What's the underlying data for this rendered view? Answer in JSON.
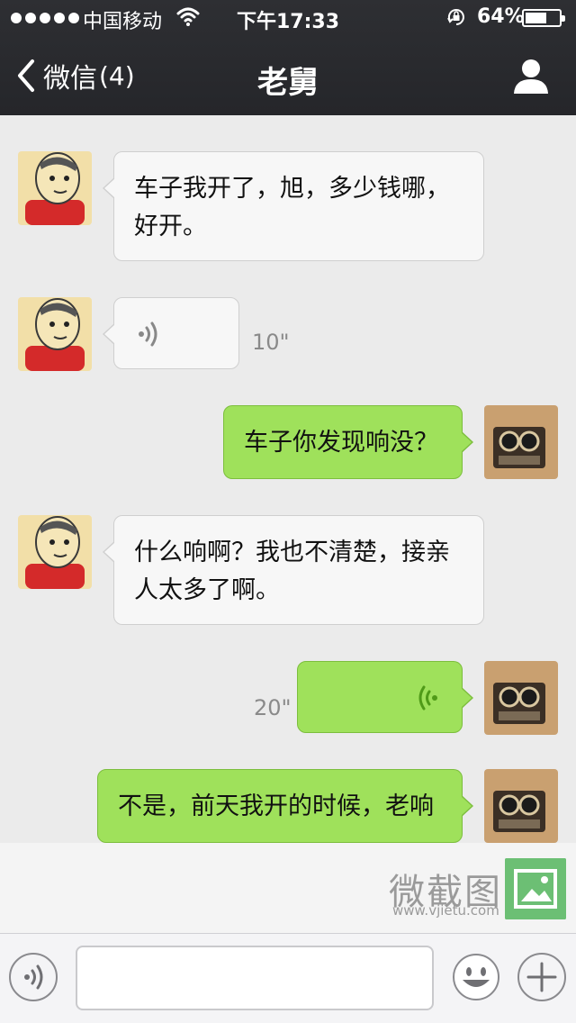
{
  "status_bar": {
    "carrier": "中国移动",
    "time": "下午17:33",
    "battery_percent": "64%",
    "battery_level": 0.64,
    "signal_bars": 5,
    "wifi_icon": "wifi-icon",
    "lock_icon": "rotation-lock-icon"
  },
  "nav": {
    "back_label": "微信",
    "unread_count": "(4)",
    "title": "老舅",
    "profile_icon": "person-icon"
  },
  "messages": [
    {
      "side": "left",
      "type": "text",
      "lines": [
        "车子我开了，旭，多少钱哪，",
        "好开。"
      ]
    },
    {
      "side": "left",
      "type": "voice",
      "duration": "10\""
    },
    {
      "side": "right",
      "type": "text",
      "lines": [
        "车子你发现响没？"
      ]
    },
    {
      "side": "left",
      "type": "text",
      "lines": [
        "什么响啊？我也不清楚，接亲",
        "人太多了啊。"
      ]
    },
    {
      "side": "right",
      "type": "voice",
      "duration": "20\""
    },
    {
      "side": "right",
      "type": "text",
      "lines": [
        "不是，前天我开的时候，老响"
      ]
    }
  ],
  "watermark": {
    "text": "微截图",
    "url": "www.vjietu.com"
  },
  "input_bar": {
    "voice_icon": "voice-mode-icon",
    "emoji_icon": "emoji-icon",
    "plus_icon": "plus-icon",
    "text_value": ""
  },
  "colors": {
    "header_bg": "#2e2f33",
    "chat_bg": "#ebebeb",
    "self_bubble": "#9fe15b",
    "other_bubble": "#f7f7f7"
  }
}
